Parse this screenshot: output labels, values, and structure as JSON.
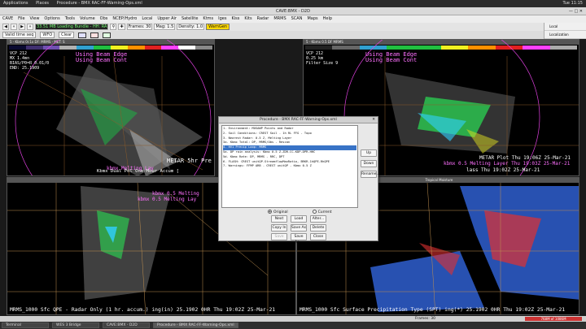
{
  "gnome": {
    "applications": "Applications",
    "places": "Places",
    "active_app": "Procedure - BMX RAC-FF-Warning-Ops.xml",
    "clock": "Tue 11:15"
  },
  "window": {
    "title": "CAVE:BMX - D2D"
  },
  "menu": [
    "CAVE",
    "File",
    "View",
    "Options",
    "Tools",
    "Volume",
    "Obs",
    "NCEP/Hydro",
    "Local",
    "Upper Air",
    "Satellite",
    "Ktms",
    "Iges",
    "Kiss",
    "Kits",
    "Radar",
    "MRMS",
    "SCAN",
    "Maps",
    "Help"
  ],
  "toolbar": {
    "loading_status": "33.51 MB Loading Bundle - HH: RA",
    "frames_label": "Frames: 30",
    "mag_label": "Mag: 1.5",
    "density_label": "Density: 1.0",
    "warngen": "WarnGen",
    "valid_time": "Valid time seq",
    "wfo": "WFO",
    "clear": "Clear",
    "local_pane": [
      "Local",
      "Localization"
    ]
  },
  "panels": {
    "top_left": {
      "header": "5 - Kbmx 0r.1x  DF: MRMS - MET: S",
      "info": "VCP 212\nMX 1.4mn\nBIAS/P0=R 0.01/0\nEND: 25.1909",
      "ann1": "Using Beam Edge",
      "ann2": "Using Beam Cont",
      "ann3": "METAR 5hr Pre",
      "ann4": "Kbmx Dual Pol One Hour Accum [",
      "ann5": "kbmx   Melting Lay"
    },
    "top_right": {
      "header": "5 - Kbmx 0.5  DF  MRMS",
      "info": "VCP 212\n0.25 km\nFilter Size 9",
      "ann1": "Using Beam Edge",
      "ann2": "Using Beam Cont",
      "ann3": "METAR Plot  Thu 19:06Z 25-Mar-21",
      "ann4": "kbmx  0.5 Melting Layer  Thu 19:03Z 25-Mar-21",
      "ann5": "lass  Thu 19:02Z 25-Mar-21"
    },
    "bottom_left": {
      "header": "Tropical Moisture",
      "ann1": "kbmx 0.5 Melting",
      "ann2": "kbmx 0.5 Melting Lay",
      "footer": "MRMS_1000 Sfc QPE - Radar Only (1 hr. accum.) ing(in)   25.1902   0HR Thu 19:02Z 25-Mar-21"
    },
    "bottom_right": {
      "header": "Tropical Moisture",
      "footer": "MRMS_1000 Sfc Surface Precipitation Type (SPT) ing(*)    25.1902   0HR Thu 19:02Z 25-Mar-21"
    }
  },
  "dialog": {
    "title": "Procedure - BMX RAC-FF-Warning-Ops.xml",
    "items": [
      "1. Environment: MUSAWP Points and Radar",
      "2. Soil Conditions: CREST Soil - 1h RL FFG - Topo",
      "3. Nearest Radar: 0.5 Z, Melting Layer",
      "3a. Kbmx Total: DP, MRMS/Obs - Rescan",
      "4. HV1 Precip Loop: MRMS",
      "5a. DP rain analysis: Kbmx 0.5 Z-ZDR-CC-KDP-DPR-HHC",
      "5d. Kbmx Rate: DP, MRMS - RRC, DPT",
      "6. FLASH: CREST unitQP-StreamflowMaxRatio, BRKR-1hQPE-RhQPE",
      "7. Warnings: FFMP ARB - CREST unitQP - Kbmx 0.5 Z"
    ],
    "selected_index": 4,
    "side_buttons": [
      "Up",
      "Down",
      "Rename..."
    ],
    "radio_original": "Original",
    "radio_current": "Current",
    "buttons": [
      "Next",
      "Load",
      "Alter...",
      "Copy In",
      "Save As",
      "Delete",
      "Save",
      "Save As...",
      "Close"
    ]
  },
  "statusbar": {
    "frames": "Frames: 30",
    "mem": "768M of 1086M"
  },
  "taskbar": [
    "Terminal",
    "WES 3 Bridge",
    "CAVE:BMX - D2D",
    "Procedure - BMX RAC-FF-Warning-Ops.xml"
  ],
  "colors": {
    "magenta": "#e040e0",
    "pink_text": "#ff70ff",
    "green": "#2adf54",
    "cyan": "#30d0ff"
  }
}
